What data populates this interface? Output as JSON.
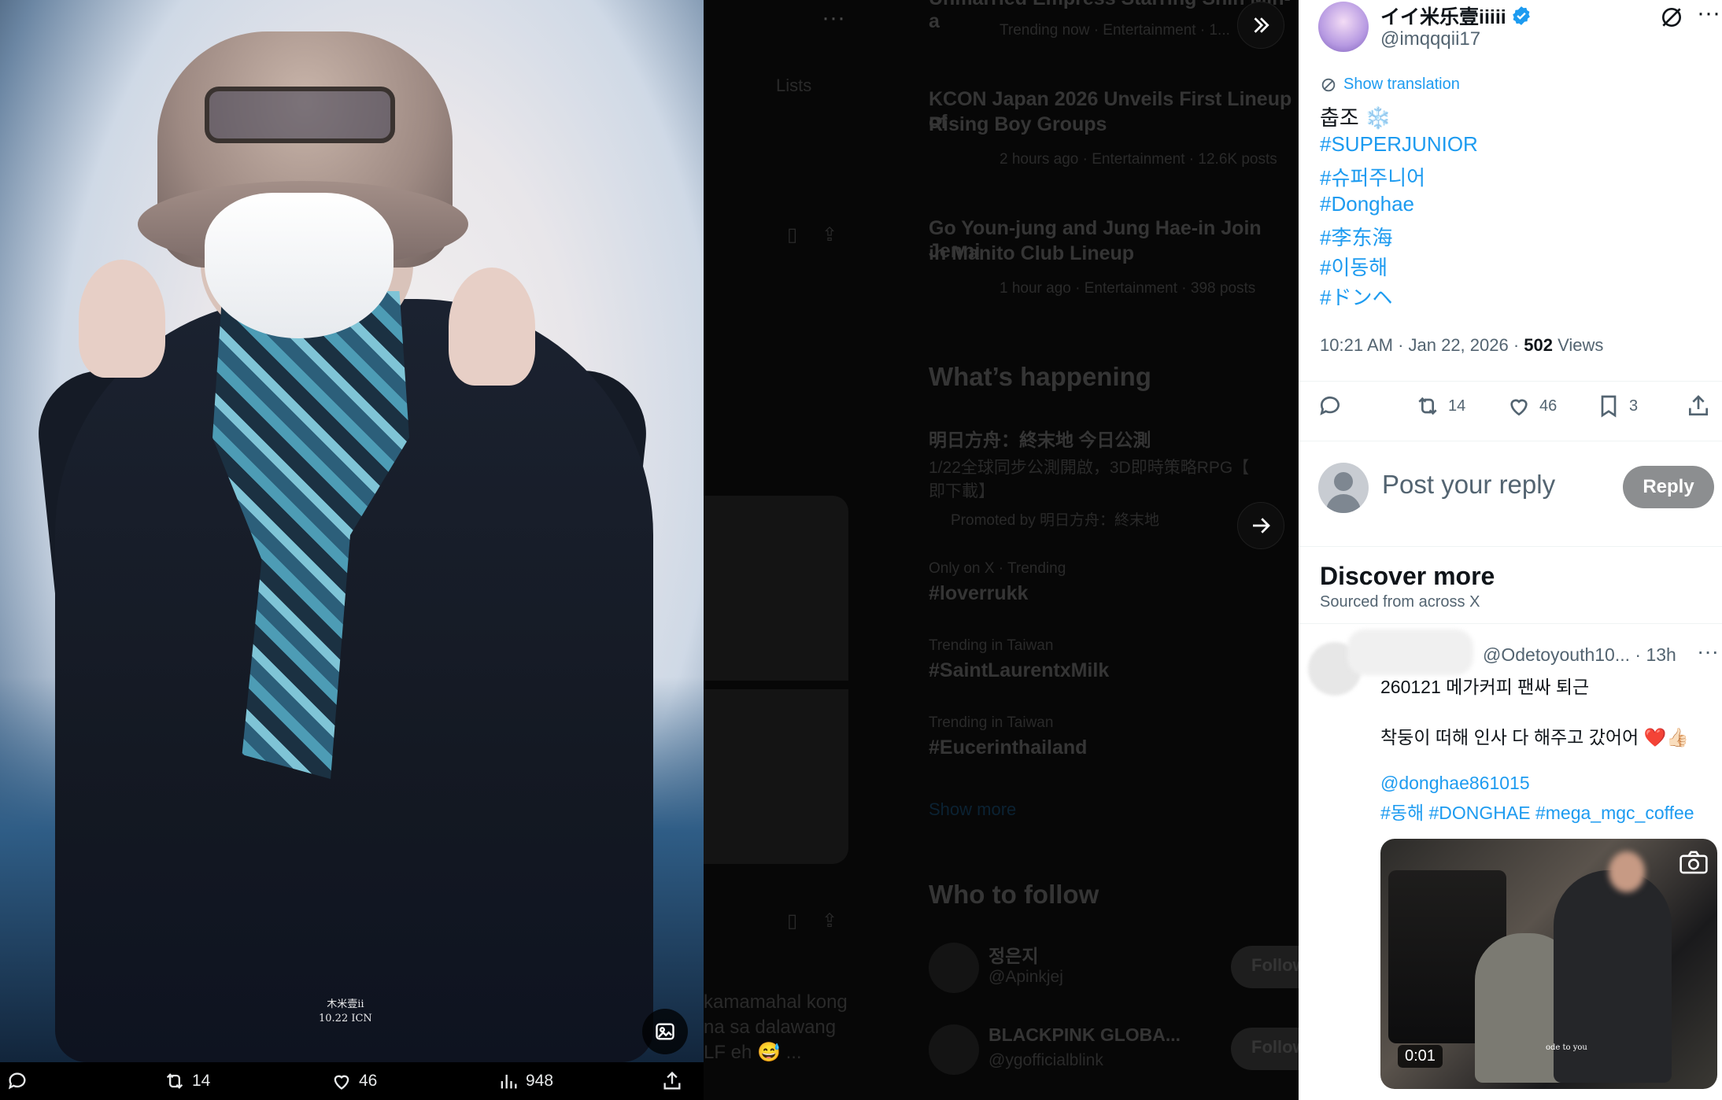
{
  "media": {
    "watermark_line1": "木米壹ii",
    "watermark_line2": "10.22 ICN",
    "bar": {
      "reply_count": "",
      "retweet_count": "14",
      "like_count": "46",
      "views_count": "948"
    }
  },
  "background": {
    "lists_label": "Lists",
    "trend_top": {
      "title": "Unmarried Empress Starring Shin Min-a",
      "meta": "Trending now · Entertainment · 1..."
    },
    "trend_kcon": {
      "title_line1": "KCON Japan 2026 Unveils First Lineup of",
      "title_line2": "Rising Boy Groups",
      "meta": "2 hours ago · Entertainment · 12.6K posts"
    },
    "trend_goyoun": {
      "title_line1": "Go Youn-jung and Jung Hae-in Join Jenni",
      "title_line2": "in Manito Club Lineup",
      "meta": "1 hour ago · Entertainment · 398 posts"
    },
    "whats_happening": "What’s happening",
    "promo": {
      "title": "明日方舟：終末地 今日公測",
      "line1": "1/22全球同步公測開啟，3D即時策略RPG【",
      "line2": "即下載】",
      "by": "Promoted by 明日方舟：終末地"
    },
    "trends": [
      {
        "context": "Only on X · Trending",
        "name": "#loverrukk"
      },
      {
        "context": "Trending in Taiwan",
        "name": "#SaintLaurentxMilk"
      },
      {
        "context": "Trending in Taiwan",
        "name": "#Eucerinthailand"
      }
    ],
    "show_more": "Show more",
    "who_to_follow": "Who to follow",
    "follow1": {
      "name": "정은지",
      "handle": "@Apinkjej",
      "button": "Follow"
    },
    "follow2": {
      "name": "BLACKPINK GLOBA...",
      "handle": "@ygofficialblink",
      "button": "Follow"
    },
    "snippet": {
      "line1": "kamamahal kong",
      "line2": "na sa dalawang",
      "line3": "LF eh 😅 ..."
    }
  },
  "post": {
    "author_name": "イイ米乐壹iiiii",
    "author_handle": "@imqqqii17",
    "show_translation": "Show translation",
    "text_line": "춥조 ❄️",
    "hashtags": [
      "#SUPERJUNIOR",
      "#슈퍼주니어",
      "#Donghae",
      "#李东海",
      "#이동해",
      "#ドンヘ"
    ],
    "timestamp": "10:21 AM · Jan 22, 2026 · ",
    "views_number": "502",
    "views_label": " Views",
    "actions": {
      "retweets": "14",
      "likes": "46",
      "bookmarks": "3"
    },
    "reply_placeholder": "Post your reply",
    "reply_button": "Reply"
  },
  "discover": {
    "title": "Discover more",
    "subtitle": "Sourced from across X",
    "item": {
      "handle": "@Odetoyouth10...",
      "time": " · 13h",
      "line1": "260121 메가커피 팬싸 퇴근",
      "line2": "착둥이 떠해 인사 다 해주고 갔어어 ❤️👍🏻",
      "mention": "@donghae861015",
      "tags": "#동해 #DONGHAE #mega_mgc_coffee",
      "video_time": "0:01",
      "video_caption": "ode to you"
    }
  },
  "colors": {
    "accent": "#1d9bf0",
    "verified": "#1d9bf0",
    "like_heart": "#f91880"
  }
}
